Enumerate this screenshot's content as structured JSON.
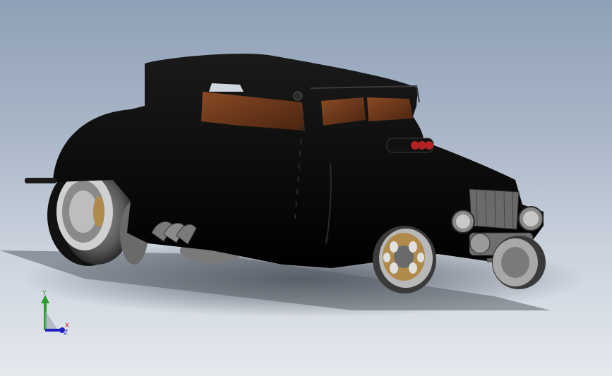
{
  "window": {
    "title": ""
  },
  "viewport": {
    "background_top": "#8fa0b6",
    "background_bottom": "#e6e9ee"
  },
  "model": {
    "name": "hot-rod-car",
    "body_color": "#050505",
    "glass_color": "#6b3a1c",
    "wheel_accent_color": "#b08a4a"
  },
  "triad": {
    "y_label": "Y",
    "x_label": "X",
    "z_label": "Z",
    "y_color": "#2d9b2d",
    "x_color": "#c02020",
    "z_color": "#2020c0"
  }
}
